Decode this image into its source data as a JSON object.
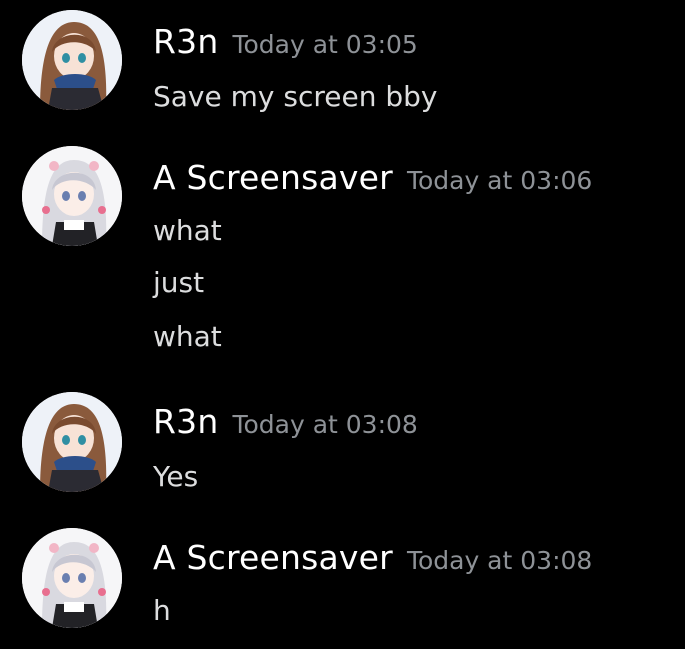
{
  "messages": [
    {
      "author": "R3n",
      "timestamp": "Today at 03:05",
      "avatar": "brown-hair-anime-girl-avatar",
      "lines": [
        "Save my screen bby"
      ]
    },
    {
      "author": "A Screensaver",
      "timestamp": "Today at 03:06",
      "avatar": "silver-hair-anime-girl-avatar",
      "lines": [
        "what",
        "just",
        "what"
      ]
    },
    {
      "author": "R3n",
      "timestamp": "Today at 03:08",
      "avatar": "brown-hair-anime-girl-avatar",
      "lines": [
        "Yes"
      ]
    },
    {
      "author": "A Screensaver",
      "timestamp": "Today at 03:08",
      "avatar": "silver-hair-anime-girl-avatar",
      "lines": [
        "h"
      ]
    }
  ],
  "colors": {
    "background": "#000000",
    "username": "#ffffff",
    "timestamp": "#8e9297",
    "message_text": "#dcddde"
  }
}
